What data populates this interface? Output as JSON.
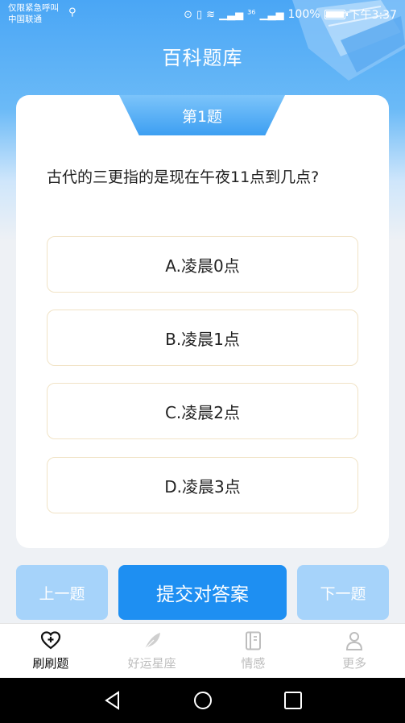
{
  "status_bar": {
    "carrier_line1": "仅限紧急呼叫",
    "carrier_line2": "中国联通",
    "network": "³⁶",
    "battery": "100%",
    "time": "下午3:37"
  },
  "header": {
    "title": "百科题库"
  },
  "question": {
    "number_label": "第1题",
    "text": "古代的三更指的是现在午夜11点到几点?",
    "options": [
      {
        "label": "A.凌晨0点"
      },
      {
        "label": "B.凌晨1点"
      },
      {
        "label": "C.凌晨2点"
      },
      {
        "label": "D.凌晨3点"
      }
    ]
  },
  "actions": {
    "prev_label": "上一题",
    "submit_label": "提交对答案",
    "next_label": "下一题"
  },
  "tabs": [
    {
      "label": "刷刷题",
      "icon": "heart-plus-icon",
      "active": true
    },
    {
      "label": "好运星座",
      "icon": "feather-icon",
      "active": false
    },
    {
      "label": "情感",
      "icon": "notebook-icon",
      "active": false
    },
    {
      "label": "更多",
      "icon": "person-icon",
      "active": false
    }
  ],
  "colors": {
    "accent": "#1e8ff2",
    "accent_light": "#a6d3fa",
    "option_border": "#f1e3c6"
  }
}
